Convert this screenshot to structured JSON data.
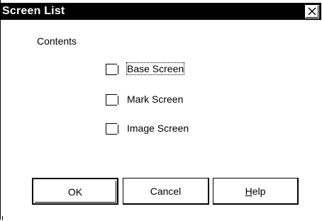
{
  "window": {
    "title": "Screen List",
    "close_icon": "close-icon"
  },
  "contents": {
    "label": "Contents",
    "checkboxes": [
      {
        "label": "Base Screen",
        "checked": false,
        "focused": true
      },
      {
        "label": "Mark Screen",
        "checked": false,
        "focused": false
      },
      {
        "label": "Image Screen",
        "checked": false,
        "focused": false
      }
    ]
  },
  "buttons": {
    "ok_label": "OK",
    "cancel_label": "Cancel",
    "help_label": "Help",
    "help_mnemonic": "H"
  }
}
